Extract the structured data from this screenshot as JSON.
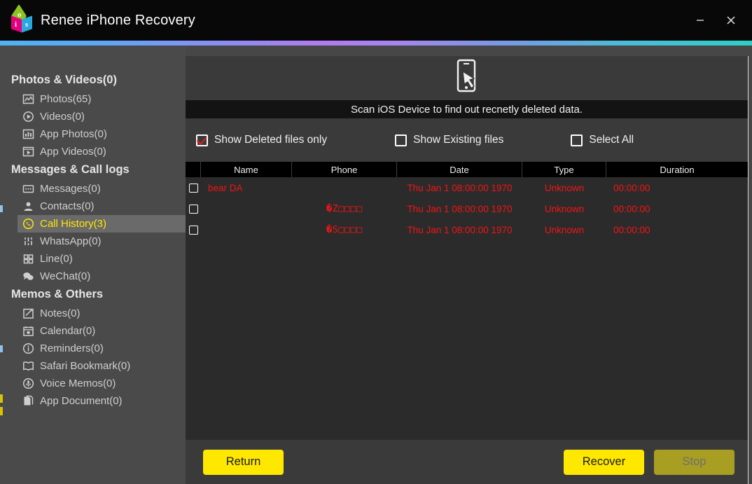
{
  "window": {
    "title": "Renee iPhone Recovery",
    "logo_letters": {
      "top": "o",
      "left": "i",
      "right": "s"
    },
    "controls": {
      "minimize": "minimize-button",
      "close": "close-button"
    },
    "accent_colors": {
      "start": "#4fb2f4",
      "mid": "#b07cf0",
      "end": "#2fcfc6"
    }
  },
  "sidebar": {
    "groups": [
      {
        "title": "Photos & Videos(0)",
        "items": [
          {
            "label": "Photos(65)",
            "icon": "image-icon",
            "selected": false
          },
          {
            "label": "Videos(0)",
            "icon": "play-circle-icon",
            "selected": false
          },
          {
            "label": "App Photos(0)",
            "icon": "bar-chart-icon",
            "selected": false
          },
          {
            "label": "App Videos(0)",
            "icon": "video-window-icon",
            "selected": false
          }
        ]
      },
      {
        "title": "Messages & Call logs",
        "items": [
          {
            "label": "Messages(0)",
            "icon": "message-icon",
            "selected": false
          },
          {
            "label": "Contacts(0)",
            "icon": "contact-person-icon",
            "selected": false
          },
          {
            "label": "Call History(3)",
            "icon": "phone-clock-icon",
            "selected": true
          },
          {
            "label": "WhatsApp(0)",
            "icon": "whatsapp-icon",
            "selected": false
          },
          {
            "label": "Line(0)",
            "icon": "line-grid-icon",
            "selected": false
          },
          {
            "label": "WeChat(0)",
            "icon": "wechat-icon",
            "selected": false
          }
        ]
      },
      {
        "title": "Memos & Others",
        "items": [
          {
            "label": "Notes(0)",
            "icon": "note-pencil-icon",
            "selected": false
          },
          {
            "label": "Calendar(0)",
            "icon": "calendar-icon",
            "selected": false
          },
          {
            "label": "Reminders(0)",
            "icon": "info-circle-icon",
            "selected": false
          },
          {
            "label": "Safari Bookmark(0)",
            "icon": "book-icon",
            "selected": false
          },
          {
            "label": "Voice Memos(0)",
            "icon": "microphone-icon",
            "selected": false
          },
          {
            "label": "App Document(0)",
            "icon": "document-icon",
            "selected": false
          }
        ]
      }
    ]
  },
  "main": {
    "banner_icon": "phone-tap-icon",
    "scan_text": "Scan iOS Device to find out recnetly deleted data.",
    "filters": [
      {
        "label": "Show Deleted files only",
        "checked": true
      },
      {
        "label": "Show Existing files",
        "checked": false
      },
      {
        "label": "Select All",
        "checked": false
      }
    ],
    "table": {
      "columns": [
        "Name",
        "Phone",
        "Date",
        "Type",
        "Duration"
      ],
      "rows": [
        {
          "checked": false,
          "name": "bear DA",
          "phone": "",
          "phone_more": "",
          "date": "Thu Jan 1 08:00:00 1970",
          "type": "Unknown",
          "duration": "00:00:00"
        },
        {
          "checked": false,
          "name": "",
          "phone": "�Z□□□□",
          "phone_more": "...",
          "date": "Thu Jan 1 08:00:00 1970",
          "type": "Unknown",
          "duration": "00:00:00"
        },
        {
          "checked": false,
          "name": "",
          "phone": "�S□□□□",
          "phone_more": "...",
          "date": "Thu Jan 1 08:00:00 1970",
          "type": "Unknown",
          "duration": "00:00:00"
        }
      ]
    }
  },
  "footer": {
    "return_label": "Return",
    "recover_label": "Recover",
    "stop_label": "Stop",
    "button_color": "#ffe800",
    "disabled_color": "#a79e22"
  }
}
